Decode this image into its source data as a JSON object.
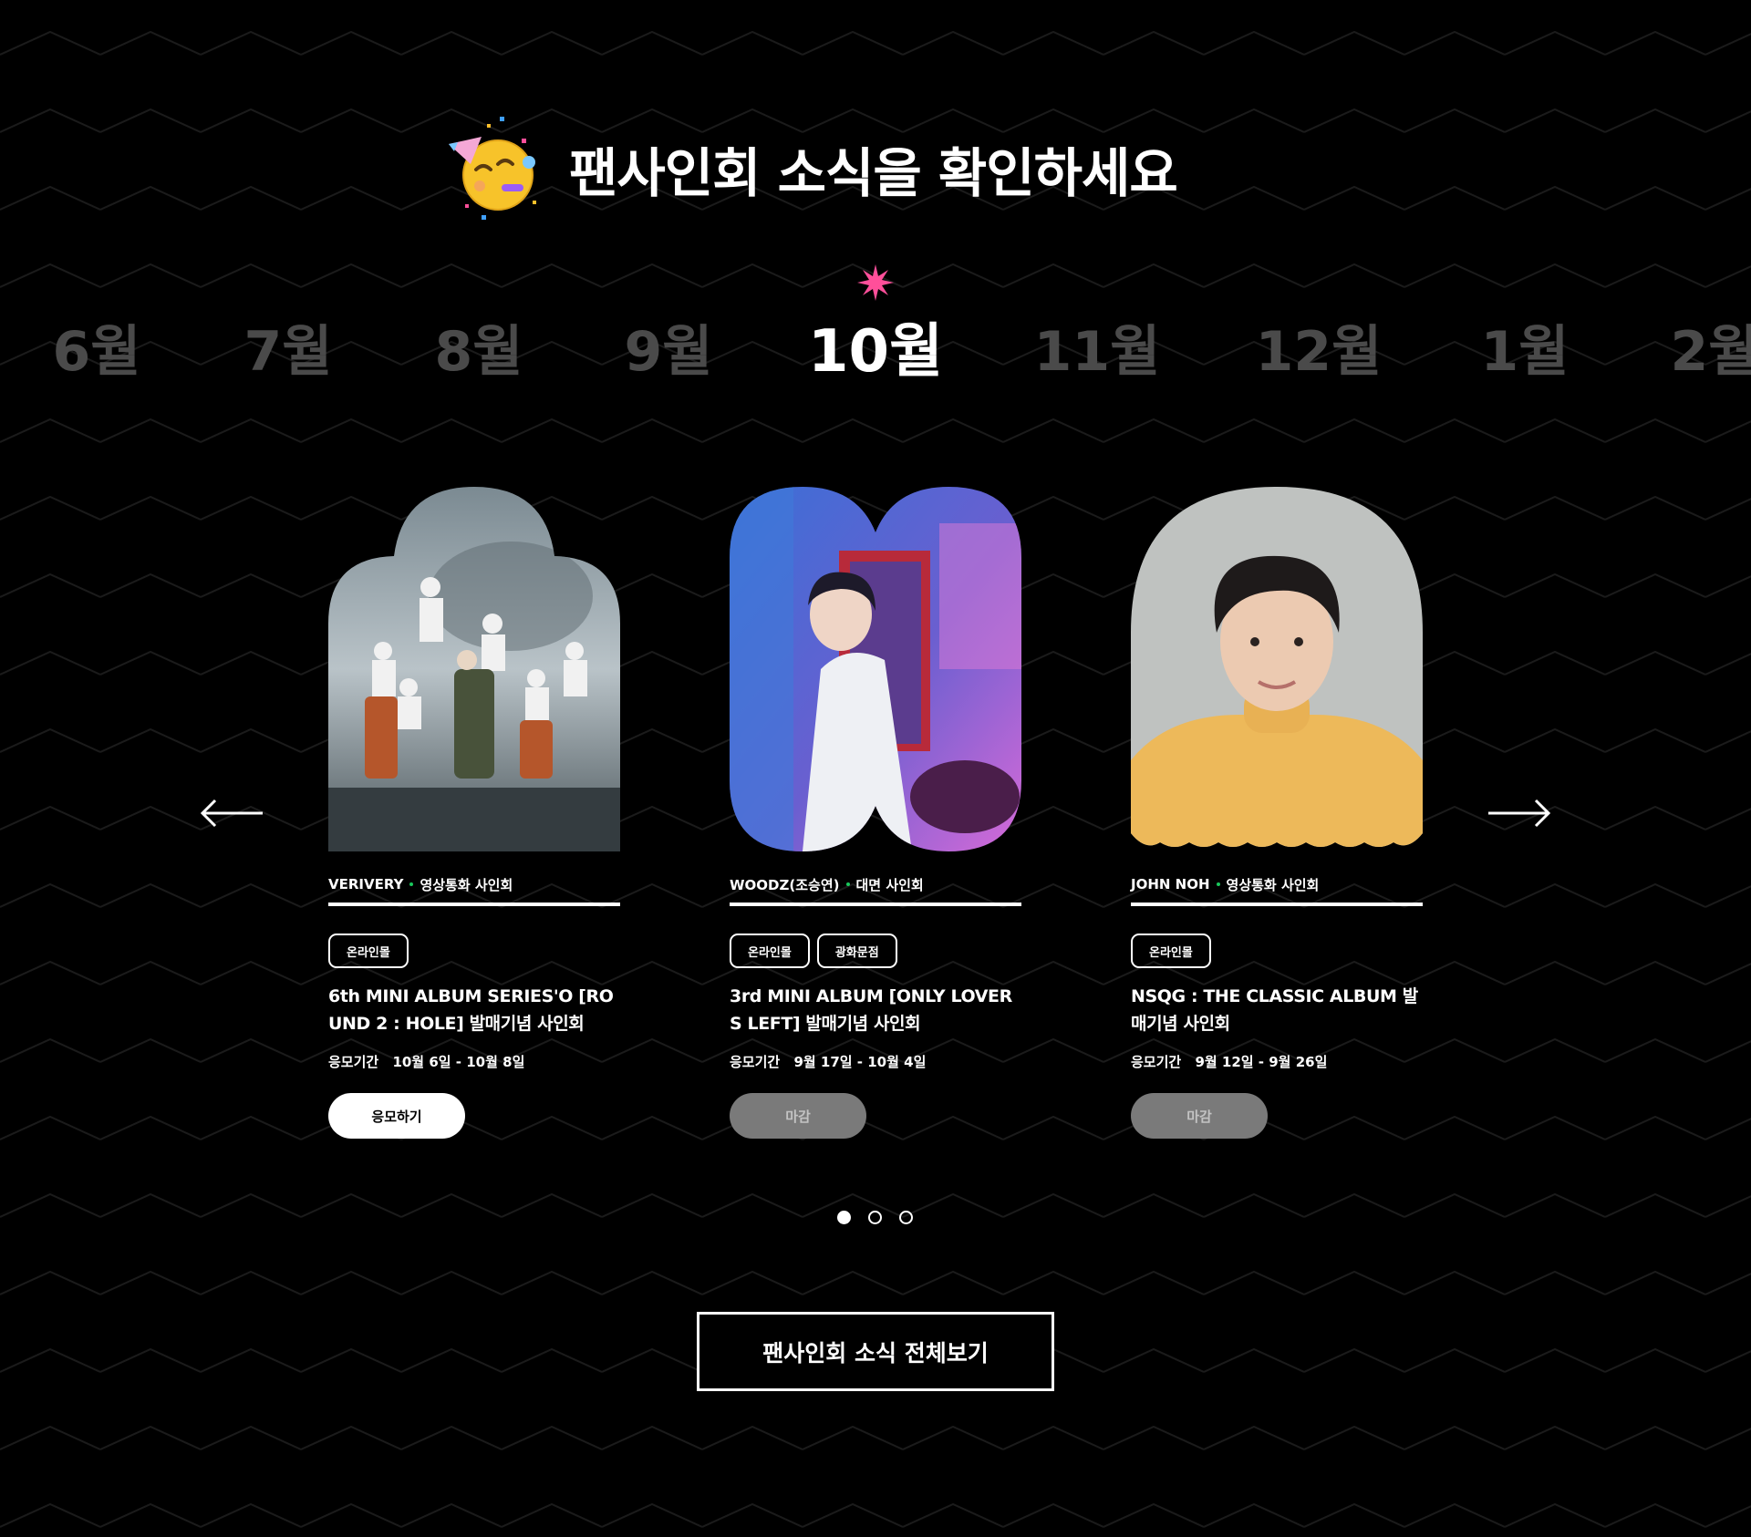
{
  "header": {
    "emoji_icon": "party-face-icon",
    "title": "팬사인회 소식을 확인하세요"
  },
  "months": {
    "items": [
      "6월",
      "7월",
      "8월",
      "9월",
      "10월",
      "11월",
      "12월",
      "1월",
      "2월"
    ],
    "active": "10월",
    "active_marker_icon": "sparkle-star-icon",
    "active_marker_color": "#ff4f9a"
  },
  "navigation": {
    "prev_icon": "arrow-left-icon",
    "next_icon": "arrow-right-icon"
  },
  "cards": [
    {
      "artist": "VERIVERY",
      "type": "영상통화 사인회",
      "tags": [
        "온라인몰"
      ],
      "title": "6th MINI ALBUM SERIES'O [ROUND 2 : HOLE] 발매기념 사인회",
      "period_label": "응모기간",
      "period": "10월 6일 - 10월 8일",
      "button": "응모하기",
      "status": "open",
      "image_alt": "group-photo"
    },
    {
      "artist": "WOODZ(조승연)",
      "type": "대면 사인회",
      "tags": [
        "온라인몰",
        "광화문점"
      ],
      "title": "3rd MINI ALBUM [ONLY LOVERS LEFT] 발매기념 사인회",
      "period_label": "응모기간",
      "period": "9월 17일 - 10월 4일",
      "button": "마감",
      "status": "closed",
      "image_alt": "solo-photo"
    },
    {
      "artist": "JOHN NOH",
      "type": "영상통화 사인회",
      "tags": [
        "온라인몰"
      ],
      "title": "NSQG : THE CLASSIC ALBUM 발매기념 사인회",
      "period_label": "응모기간",
      "period": "9월 12일 - 9월 26일",
      "button": "마감",
      "status": "closed",
      "image_alt": "portrait-photo"
    }
  ],
  "pagination": {
    "count": 3,
    "active_index": 0
  },
  "view_all_button": "팬사인회 소식 전체보기",
  "colors": {
    "background": "#000000",
    "accent_dot": "#19c85c",
    "inactive_month": "#4a4a4a",
    "closed_button": "#7a7a7a"
  }
}
